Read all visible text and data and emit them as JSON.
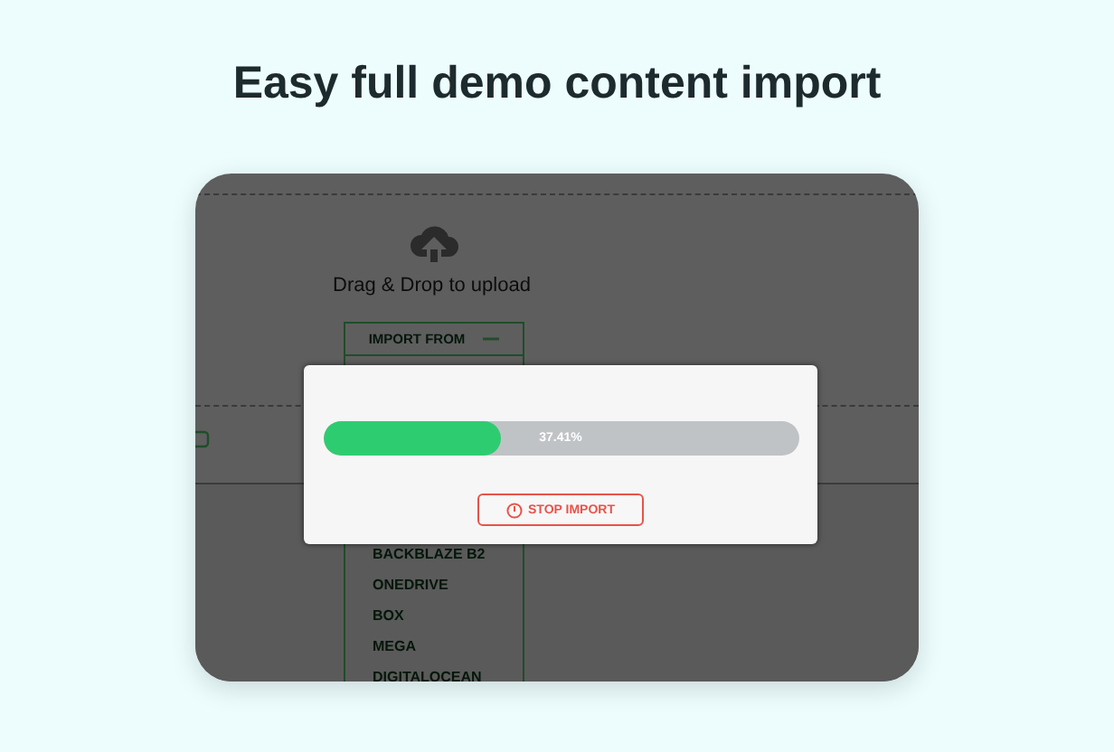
{
  "heading": "Easy full demo content import",
  "upload": {
    "label": "Drag & Drop to upload"
  },
  "dropdown": {
    "label": "IMPORT FROM",
    "expanded": true,
    "items": [
      "BACKBLAZE B2",
      "ONEDRIVE",
      "BOX",
      "MEGA",
      "DIGITALOCEAN"
    ]
  },
  "progress_dialog": {
    "level": 0.3741,
    "reading": "37.41%",
    "button": "STOP IMPORT"
  }
}
